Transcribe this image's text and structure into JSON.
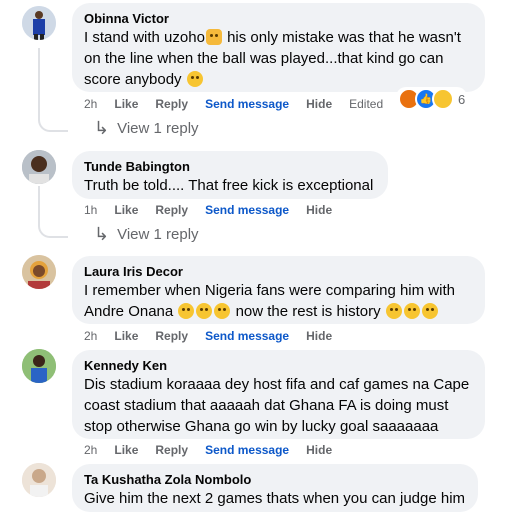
{
  "comments": [
    {
      "author": "Obinna Victor",
      "text_line1": "I stand with uzoho",
      "text_line1b": " his only mistake was that he wasn't",
      "text_line2": "on the line when the ball was played...that kind go can",
      "text_line3": "score anybody",
      "time": "2h",
      "like": "Like",
      "reply": "Reply",
      "send": "Send message",
      "hide": "Hide",
      "edited": "Edited",
      "reaction_count": "6",
      "view_replies": "View 1 reply"
    },
    {
      "author": "Tunde Babington",
      "text_line1": "Truth be told.... That free kick is exceptional",
      "time": "1h",
      "like": "Like",
      "reply": "Reply",
      "send": "Send message",
      "hide": "Hide",
      "view_replies": "View 1 reply"
    },
    {
      "author": "Laura Iris Decor",
      "text_line1": "I remember when Nigeria fans were comparing him with",
      "text_line2a": "Andre Onana",
      "text_line2b": "now the rest is history",
      "time": "2h",
      "like": "Like",
      "reply": "Reply",
      "send": "Send message",
      "hide": "Hide"
    },
    {
      "author": "Kennedy Ken",
      "text_line1": "Dis stadium koraaaa dey host fifa and caf games na Cape",
      "text_line2": "coast stadium that aaaaah dat Ghana FA is doing must",
      "text_line3": "stop otherwise Ghana go win by lucky goal saaaaaaa",
      "time": "2h",
      "like": "Like",
      "reply": "Reply",
      "send": "Send message",
      "hide": "Hide"
    },
    {
      "author": "Ta Kushatha Zola Nombolo",
      "text_line1": "Give him the next 2 games thats when you can judge him"
    }
  ],
  "colors": {
    "bubble": "#f0f2f5",
    "link_blue": "#0d58c9",
    "meta_gray": "#65676b",
    "angry": "#e9710f",
    "like_blue": "#1877f2"
  }
}
